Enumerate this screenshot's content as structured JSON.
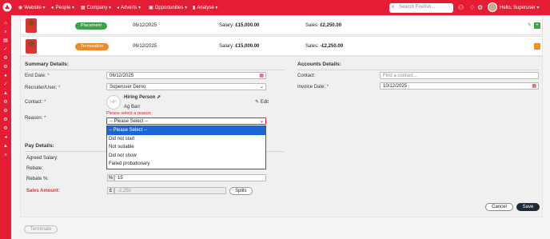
{
  "nav": {
    "items": [
      {
        "label": "Website",
        "icon": "globe-icon",
        "glyph": "◉"
      },
      {
        "label": "People",
        "icon": "person-icon",
        "glyph": "●"
      },
      {
        "label": "Company",
        "icon": "building-icon",
        "glyph": "▦"
      },
      {
        "label": "Adverts",
        "icon": "megaphone-icon",
        "glyph": "◂"
      },
      {
        "label": "Opportunities",
        "icon": "briefcase-icon",
        "glyph": "▣"
      },
      {
        "label": "Analyse",
        "icon": "bar-chart-icon",
        "glyph": "▮"
      }
    ],
    "search_placeholder": "Search Firefish...",
    "greeting": "Hello, Superuser"
  },
  "placements": [
    {
      "badge": "Placement",
      "badge_color": "#3ca34a",
      "date": "06/12/2025",
      "salary_label": "Salary: ",
      "salary": "£15,000.00",
      "sales_label": "Sales: ",
      "sales": "£2,250.00"
    },
    {
      "badge": "Termination",
      "badge_color": "#f08a24",
      "date": "06/12/2025",
      "salary_label": "Salary: ",
      "salary": "£15,000.00",
      "sales_label": "Sales: ",
      "sales": "-£2,250.00"
    }
  ],
  "summary": {
    "title": "Summary Details:",
    "end_date_label": "End Date:",
    "end_date": "06/12/2025",
    "recruiter_label": "Recruiter/User:",
    "recruiter": "Superuser Demo",
    "contact_label": "Contact:",
    "contact_initials": "HP",
    "contact_role": "Hiring Person",
    "contact_name": "Ag Barr",
    "edit_label": "Edit",
    "reason_error": "Please select a reason",
    "reason_label": "Reason:",
    "reason_value": "-- Please Select --",
    "reason_options": [
      "-- Please Select --",
      "Did not start",
      "Not suitable",
      "Did not show",
      "Failed probationary"
    ]
  },
  "accounts": {
    "title": "Accounts Details:",
    "contact_label": "Contact:",
    "contact_placeholder": "Find a contact...",
    "invoice_label": "Invoice Date:",
    "invoice_date": "10/12/2025"
  },
  "pay": {
    "title": "Pay Details:",
    "salary_label": "Agreed Salary:",
    "rebate_label": "Rebate:",
    "rebate_pct_label": "Rebate %:",
    "rebate_pct_symbol": "%",
    "rebate_pct": "15",
    "sales_amount_label": "Sales Amount:",
    "currency_symbol": "£",
    "sales_amount": "-2,250",
    "splits_label": "Splits"
  },
  "actions": {
    "cancel": "Cancel",
    "save": "Save",
    "terminate": "Terminate"
  },
  "colors": {
    "brand": "#e41c34",
    "placement": "#3ca34a",
    "termination": "#f08a24"
  }
}
